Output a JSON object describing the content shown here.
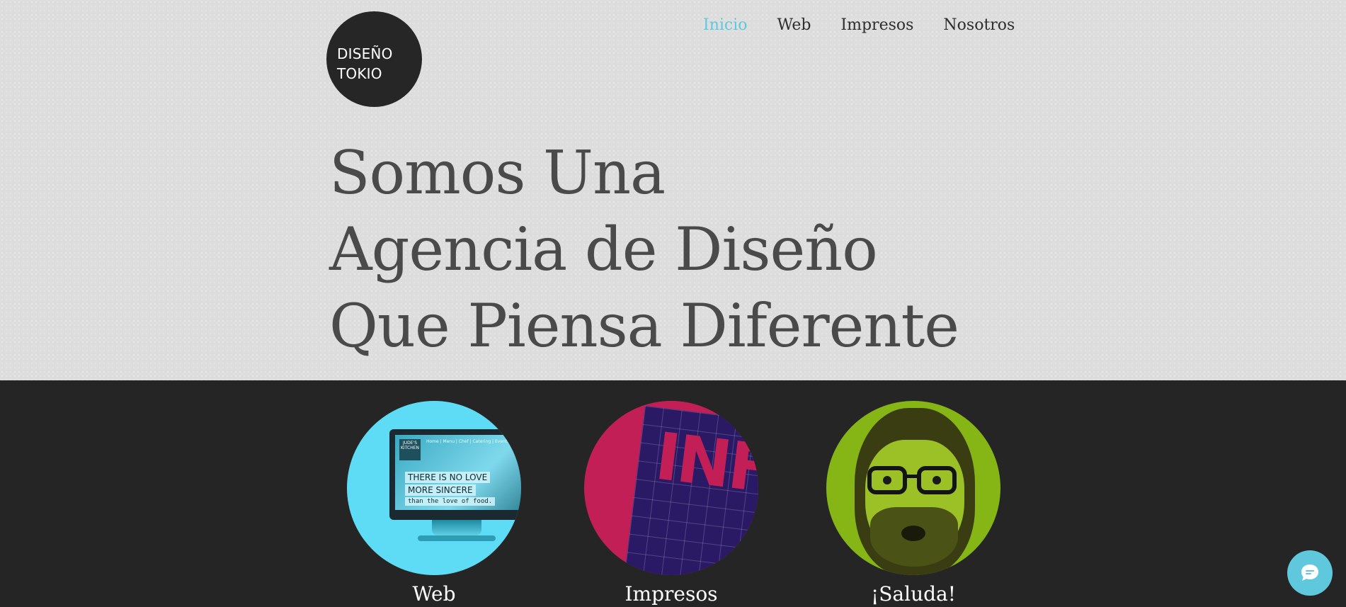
{
  "logo": {
    "line1": "DISEÑO",
    "line2": "TOKIO"
  },
  "nav": {
    "items": [
      {
        "label": "Inicio",
        "active": true
      },
      {
        "label": "Web",
        "active": false
      },
      {
        "label": "Impresos",
        "active": false
      },
      {
        "label": "Nosotros",
        "active": false
      }
    ]
  },
  "hero": {
    "line1": "Somos Una",
    "line2": "Agencia de Diseño",
    "line3": "Que Piensa Diferente"
  },
  "cards": [
    {
      "caption": "Web",
      "image": {
        "brand": "JUDE'S KITCHEN",
        "menu": "Home | Menu | Chef | Catering | Events",
        "text1": "THERE IS NO LOVE",
        "text2": "MORE SINCERE",
        "text3": "than the love of food."
      }
    },
    {
      "caption": "Impresos",
      "image": {
        "text": "INFO LIN"
      }
    },
    {
      "caption": "¡Saluda!"
    }
  ],
  "chat": {
    "icon": "chat-bubble-icon"
  },
  "colors": {
    "accent": "#5fc8dd",
    "dark": "#252525",
    "light_bg": "#dddddd"
  }
}
